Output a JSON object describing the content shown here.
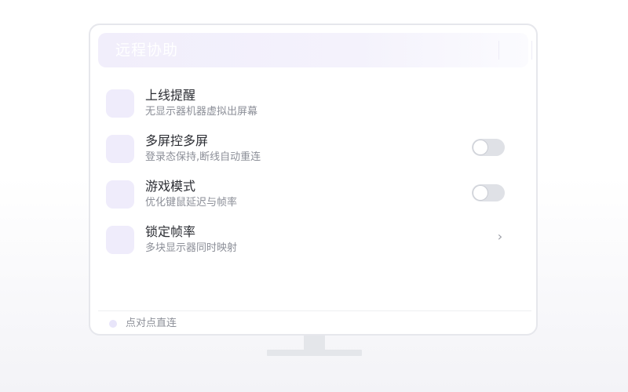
{
  "window": {
    "title": "远程协助"
  },
  "settings": [
    {
      "id": "online-reminder",
      "title": "上线提醒",
      "subtitle": "无显示器机器虚拟出屏幕",
      "control": "none"
    },
    {
      "id": "multi-screen",
      "title": "多屏控多屏",
      "subtitle": "登录态保持,断线自动重连",
      "control": "toggle",
      "enabled": false
    },
    {
      "id": "game-mode",
      "title": "游戏模式",
      "subtitle": "优化键鼠延迟与帧率",
      "control": "toggle",
      "enabled": false
    },
    {
      "id": "lock-framerate",
      "title": "锁定帧率",
      "subtitle": "多块显示器同时映射",
      "control": "chevron",
      "chevron_glyph": "›"
    }
  ],
  "footer": {
    "status_text": "点对点直连"
  },
  "colors": {
    "accent_soft": "#efecfb",
    "title_bar": "#f1eefb",
    "toggle_off": "#dfe1e6",
    "text_primary": "#2b2d33",
    "text_secondary": "#8c8f98"
  }
}
